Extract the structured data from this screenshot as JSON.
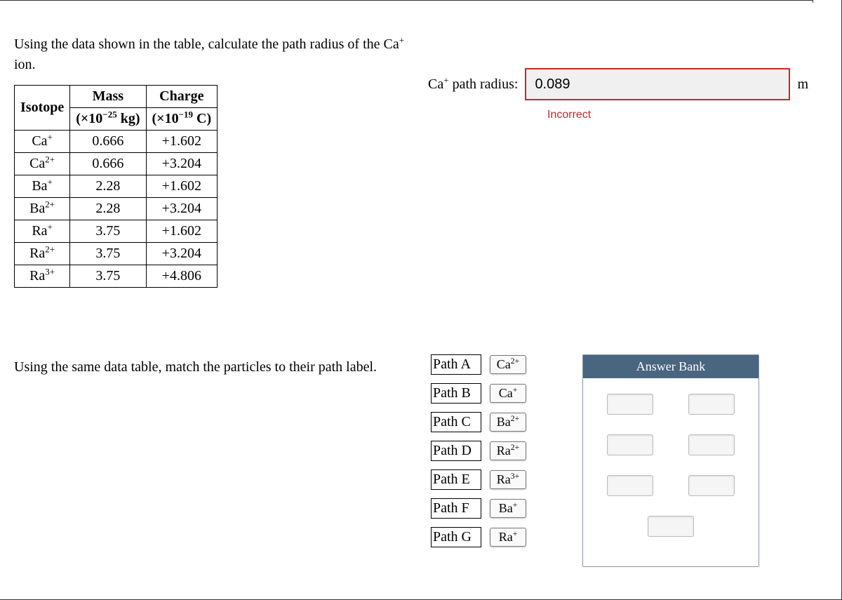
{
  "question1": {
    "prompt_part1": "Using the data shown in the table, calculate the path radius of the ",
    "prompt_target_html": "Ca<sup>+</sup>",
    "prompt_part2": " ion."
  },
  "table": {
    "headers": {
      "col1": "Isotope",
      "col2_line1": "Mass",
      "col2_line2_html": "(×10<sup>−25</sup> kg)",
      "col3_line1": "Charge",
      "col3_line2_html": "(×10<sup>−19</sup> C)"
    },
    "rows": [
      {
        "iso_html": "Ca<sup>+</sup>",
        "mass": "0.666",
        "charge": "+1.602"
      },
      {
        "iso_html": "Ca<sup>2+</sup>",
        "mass": "0.666",
        "charge": "+3.204"
      },
      {
        "iso_html": "Ba<sup>+</sup>",
        "mass": "2.28",
        "charge": "+1.602"
      },
      {
        "iso_html": "Ba<sup>2+</sup>",
        "mass": "2.28",
        "charge": "+3.204"
      },
      {
        "iso_html": "Ra<sup>+</sup>",
        "mass": "3.75",
        "charge": "+1.602"
      },
      {
        "iso_html": "Ra<sup>2+</sup>",
        "mass": "3.75",
        "charge": "+3.204"
      },
      {
        "iso_html": "Ra<sup>3+</sup>",
        "mass": "3.75",
        "charge": "+4.806"
      }
    ]
  },
  "answer": {
    "label_html": "Ca<sup>+</sup> path radius:",
    "value": "0.089",
    "unit": "m",
    "feedback": "Incorrect"
  },
  "question2": {
    "prompt": "Using the same data table, match the particles to their path label."
  },
  "matches": [
    {
      "label": "Path A",
      "chip_html": "Ca<sup>2+</sup>"
    },
    {
      "label": "Path B",
      "chip_html": "Ca<sup>+</sup>"
    },
    {
      "label": "Path C",
      "chip_html": "Ba<sup>2+</sup>"
    },
    {
      "label": "Path D",
      "chip_html": "Ra<sup>2+</sup>"
    },
    {
      "label": "Path E",
      "chip_html": "Ra<sup>3+</sup>"
    },
    {
      "label": "Path F",
      "chip_html": "Ba<sup>+</sup>"
    },
    {
      "label": "Path G",
      "chip_html": "Ra<sup>+</sup>"
    }
  ],
  "bank": {
    "title": "Answer Bank",
    "slots": 7
  }
}
